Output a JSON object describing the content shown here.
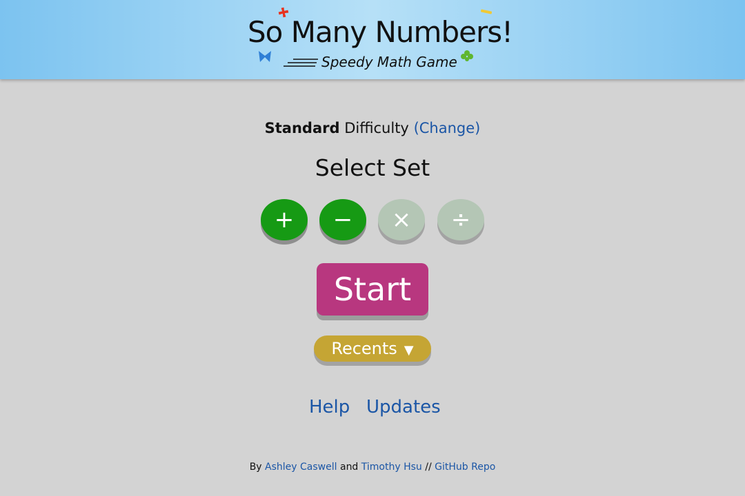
{
  "header": {
    "title": "So Many Numbers!",
    "subtitle": "Speedy Math Game"
  },
  "difficulty": {
    "level": "Standard",
    "label": "Difficulty",
    "change_link": "(Change)"
  },
  "select_set": {
    "heading": "Select Set",
    "operations": [
      {
        "symbol": "+",
        "name": "addition",
        "selected": true
      },
      {
        "symbol": "−",
        "name": "subtraction",
        "selected": true
      },
      {
        "symbol": "×",
        "name": "multiplication",
        "selected": false
      },
      {
        "symbol": "÷",
        "name": "division",
        "selected": false
      }
    ]
  },
  "start_button": "Start",
  "recents": {
    "label": "Recents",
    "arrow": "▼"
  },
  "links": {
    "help": "Help",
    "updates": "Updates"
  },
  "footer": {
    "by": "By",
    "author1": "Ashley Caswell",
    "and": "and",
    "author2": "Timothy Hsu",
    "separator": "//",
    "repo": "GitHub Repo"
  },
  "colors": {
    "background": "#d3d3d3",
    "header_gradient_edge": "#7cc3f0",
    "header_gradient_mid": "#b6e0f7",
    "op_selected": "#169a14",
    "op_unselected": "#b4c6b5",
    "start": "#b8377f",
    "recents": "#c5a534",
    "link": "#1b56a6"
  },
  "icons": [
    "plus-decoration-icon",
    "bowtie-decoration-icon",
    "dash-decoration-icon",
    "clover-decoration-icon"
  ]
}
